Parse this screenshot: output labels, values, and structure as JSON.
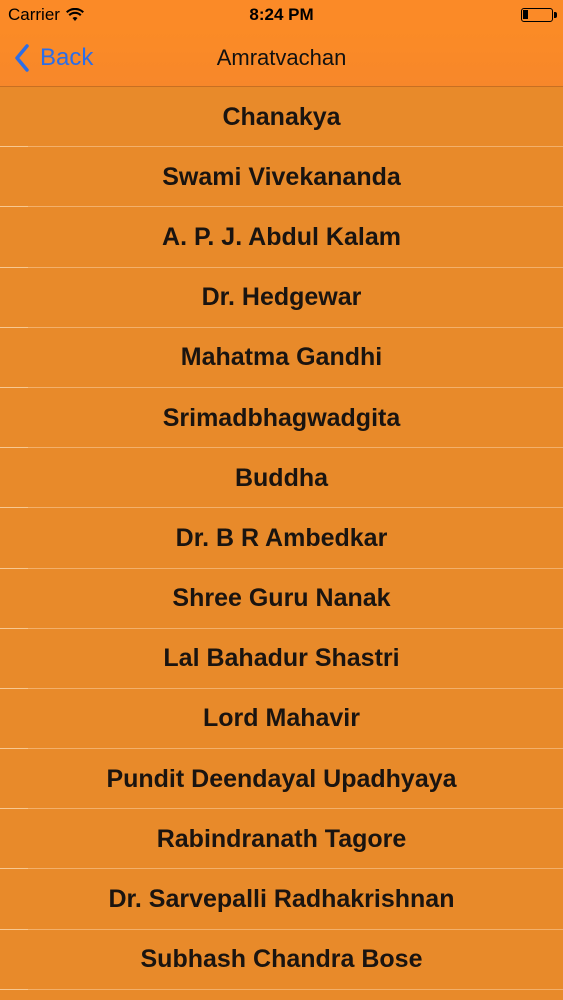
{
  "status": {
    "carrier": "Carrier",
    "time": "8:24 PM",
    "icons": [
      "wifi-icon",
      "battery-icon"
    ]
  },
  "nav": {
    "back_label": "Back",
    "title": "Amratvachan",
    "back_color": "#2c6ee8"
  },
  "list": {
    "items": [
      "Chanakya",
      "Swami Vivekananda",
      "A. P. J. Abdul Kalam",
      "Dr. Hedgewar",
      "Mahatma Gandhi",
      "Srimadbhagwadgita",
      "Buddha",
      "Dr. B R Ambedkar",
      "Shree Guru Nanak",
      "Lal Bahadur Shastri",
      "Lord Mahavir",
      "Pundit Deendayal Upadhyaya",
      "Rabindranath Tagore",
      "Dr. Sarvepalli Radhakrishnan",
      "Subhash Chandra Bose"
    ]
  },
  "colors": {
    "header": "#fb8a27",
    "row_background": "#e88a2a"
  }
}
